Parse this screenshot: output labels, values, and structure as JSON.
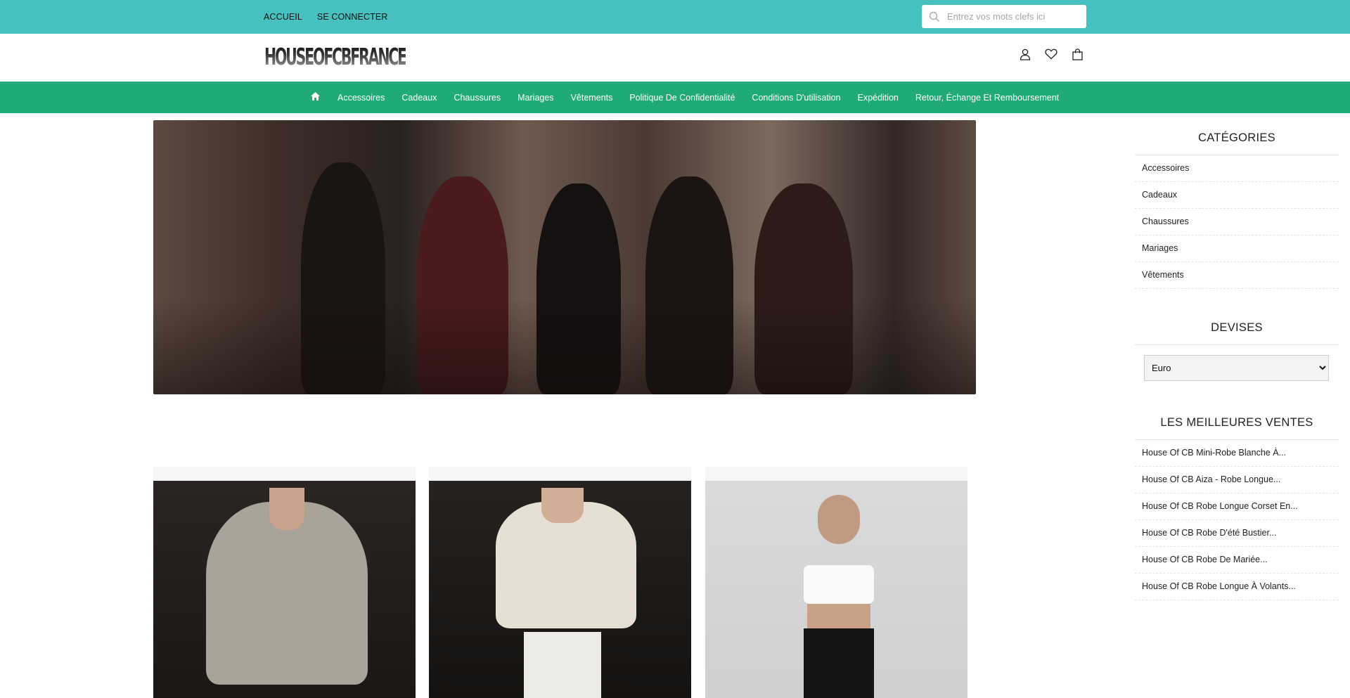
{
  "topbar": {
    "home_label": "ACCUEIL",
    "login_label": "SE CONNECTER",
    "search_placeholder": "Entrez vos mots clefs ici"
  },
  "header": {
    "logo_text": "HOUSEOFCBFRANCE",
    "icons": [
      "user-icon",
      "heart-icon",
      "shopping-bag-icon"
    ]
  },
  "nav": {
    "home_icon": "home-icon",
    "items": [
      "Accessoires",
      "Cadeaux",
      "Chaussures",
      "Mariages",
      "Vêtements",
      "Politique De Confidentialité",
      "Conditions D'utilisation",
      "Expédition",
      "Retour, Échange Et Remboursement"
    ]
  },
  "sidebar": {
    "categories_title": "CATÉGORIES",
    "categories": [
      "Accessoires",
      "Cadeaux",
      "Chaussures",
      "Mariages",
      "Vêtements"
    ],
    "currency_title": "DEVISES",
    "currency_selected": "Euro",
    "bestsellers_title": "LES MEILLEURES VENTES",
    "bestsellers": [
      "House Of CB Mini-Robe Blanche À...",
      "House Of CB Aiza - Robe Longue...",
      "House Of CB Robe Longue Corset En...",
      "House Of CB Robe D'été Bustier...",
      "House Of CB Robe De Mariée...",
      "House Of CB Robe Longue À Volants..."
    ]
  },
  "colors": {
    "topbar": "#47c1bf",
    "nav": "#1faa77"
  }
}
